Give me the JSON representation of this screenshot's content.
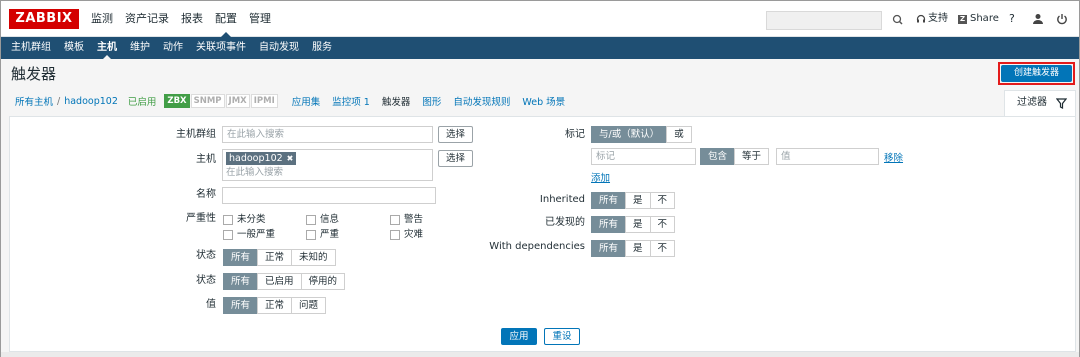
{
  "logo": "ZABBIX",
  "top_menu": [
    "监测",
    "资产记录",
    "报表",
    "配置",
    "管理"
  ],
  "top_right": {
    "support": "支持",
    "share": "Share",
    "share_badge": "Z",
    "help": "?"
  },
  "sub_menu": [
    "主机群组",
    "模板",
    "主机",
    "维护",
    "动作",
    "关联项事件",
    "自动发现",
    "服务"
  ],
  "page_title": "触发器",
  "create_button": "创建触发器",
  "breadcrumb": {
    "all_hosts": "所有主机",
    "separator": "/",
    "host": "hadoop102",
    "enabled": "已启用",
    "badges": [
      "ZBX",
      "SNMP",
      "JMX",
      "IPMI"
    ],
    "tabs": [
      "应用集",
      "监控项 1",
      "触发器",
      "图形",
      "自动发现规则",
      "Web 场景"
    ]
  },
  "filter_tab": "过滤器",
  "filter": {
    "host_group_label": "主机群组",
    "host_group_placeholder": "在此输入搜索",
    "select_label": "选择",
    "host_label": "主机",
    "host_token": "hadoop102",
    "host_token_remove": "✖",
    "host_placeholder": "在此输入搜索",
    "name_label": "名称",
    "severity_label": "严重性",
    "severities": [
      "未分类",
      "信息",
      "警告",
      "一般严重",
      "严重",
      "灾难"
    ],
    "state_label": "状态",
    "state_options": [
      "所有",
      "正常",
      "未知的"
    ],
    "status_label": "状态",
    "status_options": [
      "所有",
      "已启用",
      "停用的"
    ],
    "value_label": "值",
    "value_options": [
      "所有",
      "正常",
      "问题"
    ],
    "tags_label": "标记",
    "tags_mode": [
      "与/或（默认）",
      "或"
    ],
    "tag_placeholder": "标记",
    "tag_ops": [
      "包含",
      "等于"
    ],
    "value_placeholder": "值",
    "remove_link": "移除",
    "add_link": "添加",
    "inherited_label": "Inherited",
    "inherited_options": [
      "所有",
      "是",
      "不"
    ],
    "discovered_label": "已发现的",
    "discovered_options": [
      "所有",
      "是",
      "不"
    ],
    "deps_label": "With dependencies",
    "deps_options": [
      "所有",
      "是",
      "不"
    ],
    "apply": "应用",
    "reset": "重设"
  }
}
